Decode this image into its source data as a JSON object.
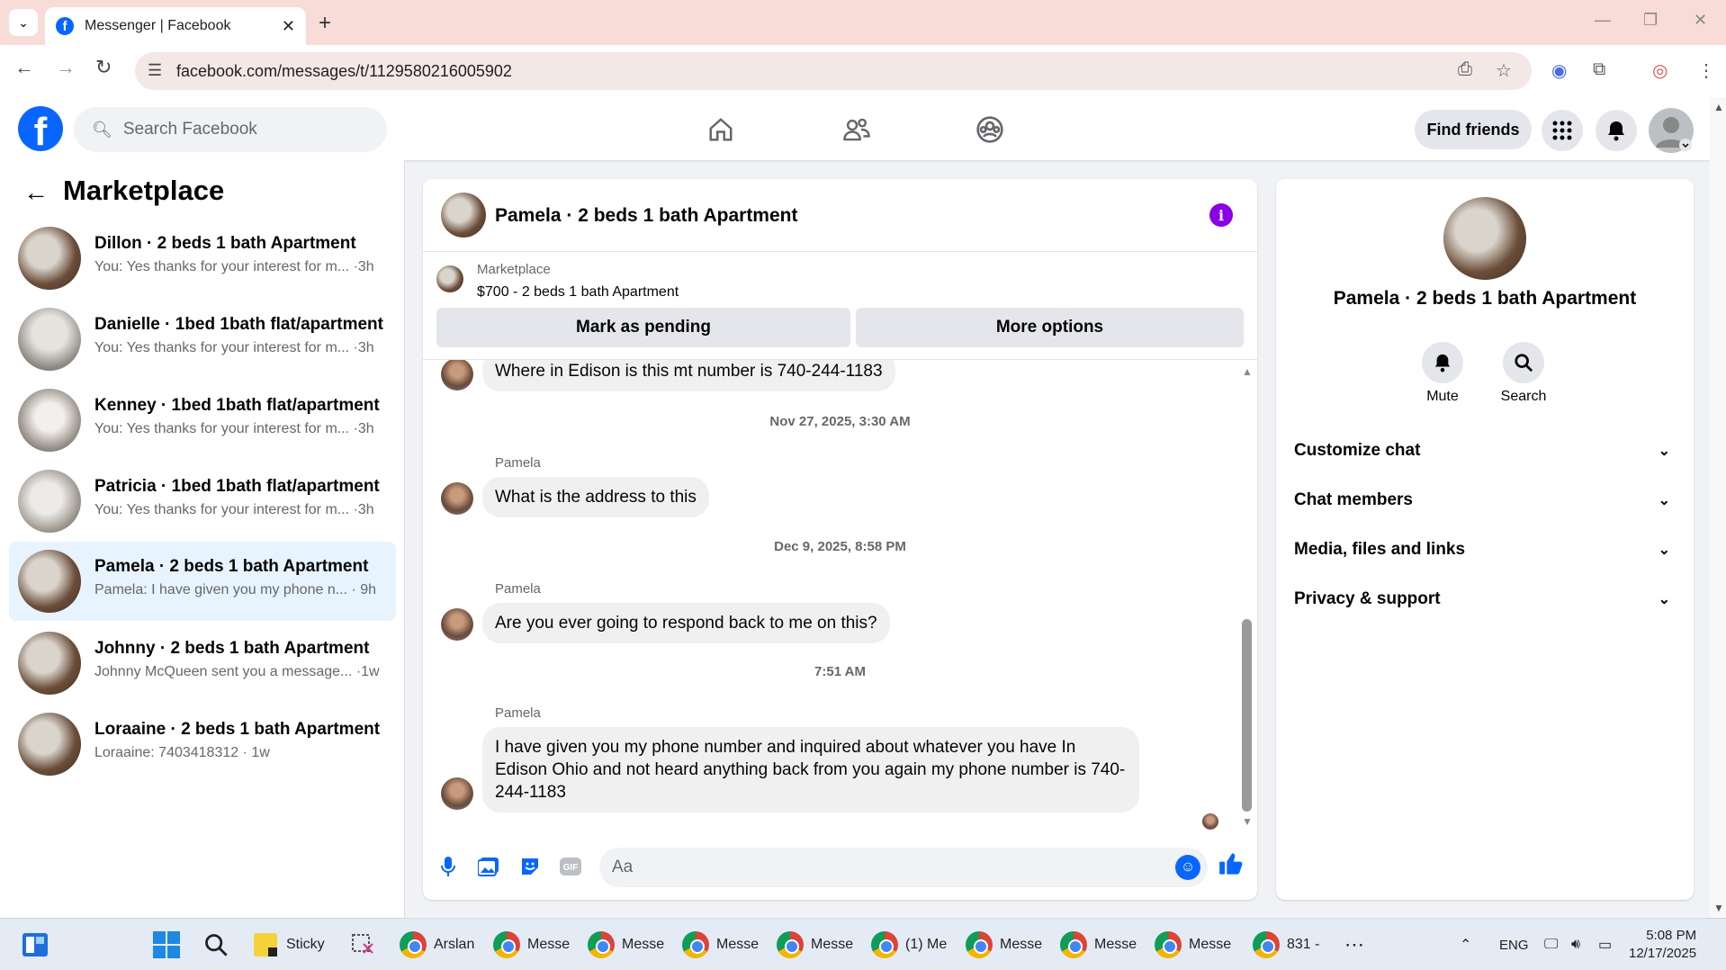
{
  "browser": {
    "tab_title": "Messenger | Facebook",
    "url": "facebook.com/messages/t/1129580216005902"
  },
  "fb": {
    "search_placeholder": "Search Facebook",
    "find_friends": "Find friends"
  },
  "sidebar": {
    "title": "Marketplace",
    "conversations": [
      {
        "name": "Dillon · 2 beds 1 bath Apartment",
        "preview": "You: Yes thanks for your interest for m... ·3h",
        "active": false
      },
      {
        "name": "Danielle · 1bed 1bath flat/apartment",
        "preview": "You: Yes thanks for your interest for m... ·3h",
        "active": false
      },
      {
        "name": "Kenney · 1bed 1bath flat/apartment",
        "preview": "You: Yes thanks for your interest for m... ·3h",
        "active": false
      },
      {
        "name": "Patricia · 1bed 1bath flat/apartment",
        "preview": "You: Yes thanks for your interest for m... ·3h",
        "active": false
      },
      {
        "name": "Pamela · 2 beds 1 bath Apartment",
        "preview": "Pamela: I have given you my phone n... · 9h",
        "active": true
      },
      {
        "name": "Johnny · 2 beds 1 bath Apartment",
        "preview": "Johnny McQueen sent you a message... ·1w",
        "active": false
      },
      {
        "name": "Loraaine · 2 beds 1 bath Apartment",
        "preview": "Loraaine: 7403418312 · 1w",
        "active": false
      }
    ]
  },
  "chat": {
    "title": "Pamela · 2 beds 1 bath Apartment",
    "marketplace_label": "Marketplace",
    "listing": "$700 - 2 beds 1 bath Apartment",
    "mark_pending": "Mark as pending",
    "more_options": "More options",
    "messages": {
      "m1": "Where in Edison is this mt number is 740-244-1183",
      "t1": "Nov 27, 2025, 3:30 AM",
      "s2": "Pamela",
      "m2": "What is the address to this",
      "t2": "Dec 9, 2025, 8:58 PM",
      "s3": "Pamela",
      "m3": "Are you ever going to respond back to me on this?",
      "t3": "7:51 AM",
      "s4": "Pamela",
      "m4": "I have given you my phone number and inquired about whatever you have In Edison Ohio and not heard anything back from you again my phone number is 740-244-1183"
    },
    "composer_placeholder": "Aa"
  },
  "right": {
    "title": "Pamela · 2 beds 1 bath Apartment",
    "mute": "Mute",
    "search": "Search",
    "rows": [
      "Customize chat",
      "Chat members",
      "Media, files and links",
      "Privacy & support"
    ]
  },
  "taskbar": {
    "sticky": "Sticky",
    "items": [
      "Arslan",
      "Messe",
      "Messe",
      "Messe",
      "Messe",
      "(1) Me",
      "Messe",
      "Messe",
      "Messe",
      "831 -"
    ],
    "lang": "ENG",
    "time": "5:08 PM",
    "date": "12/17/2025"
  },
  "colors": {
    "fb_blue": "#0866ff",
    "active_row": "#e7f3ff",
    "info_purple": "#8a00e6"
  }
}
